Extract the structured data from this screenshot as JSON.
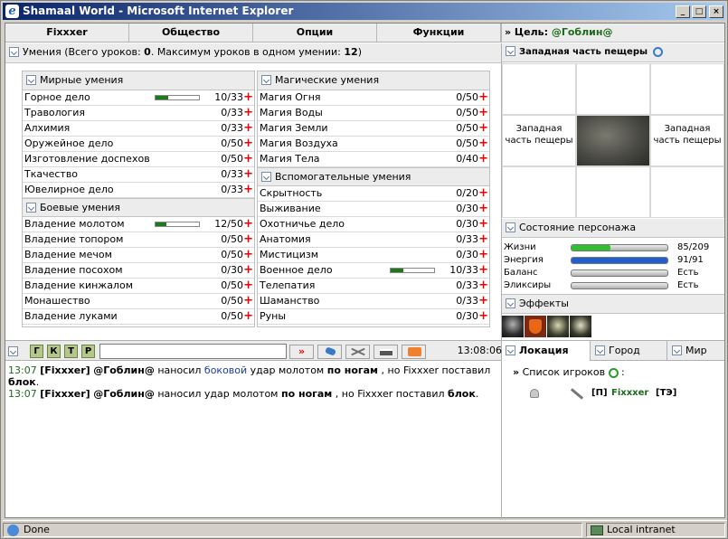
{
  "window": {
    "title": "Shamaal World - Microsoft Internet Explorer",
    "min": "_",
    "max": "□",
    "close": "×"
  },
  "tabs": [
    "Fixxxer",
    "Общество",
    "Опции",
    "Функции"
  ],
  "skills_header": {
    "label": "Умения (Всего уроков: ",
    "total": "0",
    "mid": ". Максимум уроков в одном умении: ",
    "max": "12",
    "end": ")"
  },
  "target": {
    "prefix": "» Цель:",
    "name": "@Гоблин@"
  },
  "peaceful": {
    "title": "Мирные умения",
    "rows": [
      {
        "name": "Горное дело",
        "value": "10/33",
        "progress": 0.3
      },
      {
        "name": "Травология",
        "value": "0/33"
      },
      {
        "name": "Алхимия",
        "value": "0/33"
      },
      {
        "name": "Оружейное дело",
        "value": "0/50"
      },
      {
        "name": "Изготовление доспехов",
        "value": "0/50"
      },
      {
        "name": "Ткачество",
        "value": "0/33"
      },
      {
        "name": "Ювелирное дело",
        "value": "0/33"
      }
    ]
  },
  "combat": {
    "title": "Боевые умения",
    "rows": [
      {
        "name": "Владение молотом",
        "value": "12/50",
        "progress": 0.24
      },
      {
        "name": "Владение топором",
        "value": "0/50"
      },
      {
        "name": "Владение мечом",
        "value": "0/50"
      },
      {
        "name": "Владение посохом",
        "value": "0/30"
      },
      {
        "name": "Владение кинжалом",
        "value": "0/50"
      },
      {
        "name": "Монашество",
        "value": "0/50"
      },
      {
        "name": "Владение луками",
        "value": "0/50"
      }
    ]
  },
  "magic": {
    "title": "Магические умения",
    "rows": [
      {
        "name": "Магия Огня",
        "value": "0/50"
      },
      {
        "name": "Магия Воды",
        "value": "0/50"
      },
      {
        "name": "Магия Земли",
        "value": "0/50"
      },
      {
        "name": "Магия Воздуха",
        "value": "0/50"
      },
      {
        "name": "Магия Тела",
        "value": "0/40"
      }
    ]
  },
  "aux": {
    "title": "Вспомогательные умения",
    "rows": [
      {
        "name": "Скрытность",
        "value": "0/20"
      },
      {
        "name": "Выживание",
        "value": "0/30"
      },
      {
        "name": "Охотничье дело",
        "value": "0/30"
      },
      {
        "name": "Анатомия",
        "value": "0/33"
      },
      {
        "name": "Мистицизм",
        "value": "0/30"
      },
      {
        "name": "Военное дело",
        "value": "10/33",
        "progress": 0.3
      },
      {
        "name": "Телепатия",
        "value": "0/33"
      },
      {
        "name": "Шаманство",
        "value": "0/33"
      },
      {
        "name": "Руны",
        "value": "0/30"
      }
    ]
  },
  "plus_sign": "+",
  "location": {
    "title": "Западная часть пещеры",
    "left": "Западная часть пещеры",
    "right": "Западная часть пещеры"
  },
  "state": {
    "title": "Состояние персонажа",
    "rows": [
      {
        "name": "Жизни",
        "value": "85/209",
        "fill": 0.41,
        "color": "#2fbf2f"
      },
      {
        "name": "Энергия",
        "value": "91/91",
        "fill": 1.0,
        "color": "#1f5fd0"
      },
      {
        "name": "Баланс",
        "value": "Есть",
        "fill": 0
      },
      {
        "name": "Эликсиры",
        "value": "Есть",
        "fill": 0
      }
    ]
  },
  "effects": {
    "title": "Эффекты"
  },
  "chat_toolbar": {
    "buttons": [
      "Г",
      "К",
      "Т",
      "Р"
    ],
    "input_value": "",
    "send": "»",
    "time": "13:08:06"
  },
  "chat": [
    {
      "time": "13:07",
      "who": "[Fixxxer]",
      "target": "@Гоблин@",
      "t1": " наносил ",
      "hl": "боковой",
      "t2": " удар молотом ",
      "b1": "по ногам",
      "t3": " , но Fixxxer поставил ",
      "b2": "блок",
      "t4": "."
    },
    {
      "time": "13:07",
      "who": "[Fixxxer]",
      "target": "@Гоблин@",
      "t1": " наносил удар молотом ",
      "hl": "",
      "t2": "",
      "b1": "по ногам",
      "t3": " , но Fixxxer поставил ",
      "b2": "блок",
      "t4": "."
    }
  ],
  "bottom_tabs": [
    "Локация",
    "Город",
    "Мир"
  ],
  "players": {
    "title": "Список игроков",
    "colon": " :",
    "entries": [
      {
        "clan": "[П]",
        "name": "Fixxxer",
        "rank": "[ТЭ]"
      }
    ]
  },
  "statusbar": {
    "done": "Done",
    "zone": "Local intranet"
  }
}
